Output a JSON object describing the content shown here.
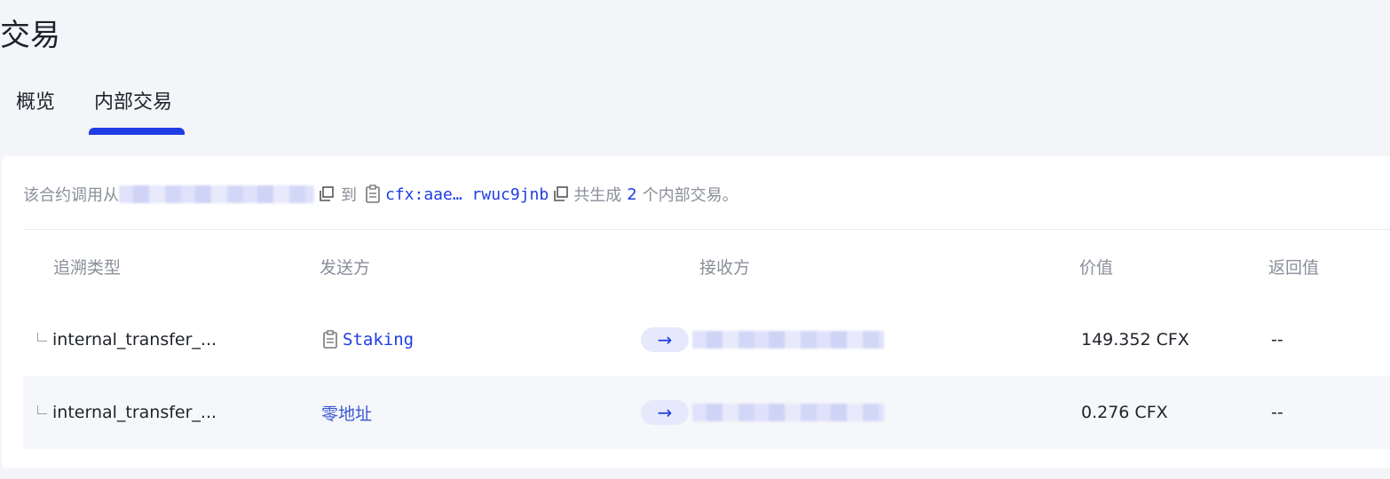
{
  "page": {
    "title": "交易"
  },
  "tabs": [
    {
      "label": "概览",
      "active": false
    },
    {
      "label": "内部交易",
      "active": true
    }
  ],
  "summary": {
    "prefix": "该合约调用从",
    "to_word": "到",
    "contract_address": "cfx:aae… rwuc9jnb",
    "generated_prefix": "共生成",
    "count": "2",
    "generated_suffix": "个内部交易。"
  },
  "table": {
    "columns": [
      "追溯类型",
      "发送方",
      "接收方",
      "价值",
      "返回值"
    ],
    "rows": [
      {
        "type": "internal_transfer_...",
        "from": "Staking",
        "from_is_contract": true,
        "value": "149.352 CFX",
        "return": "--"
      },
      {
        "type": "internal_transfer_...",
        "from": "零地址",
        "from_is_contract": false,
        "value": "0.276 CFX",
        "return": "--"
      }
    ]
  },
  "colors": {
    "accent": "#1e3de4",
    "muted_text": "#8a8f99",
    "background": "#f4f5f9"
  },
  "icons": {
    "copy": "copy-icon",
    "contract": "contract-icon",
    "arrow": "arrow-right-icon"
  }
}
